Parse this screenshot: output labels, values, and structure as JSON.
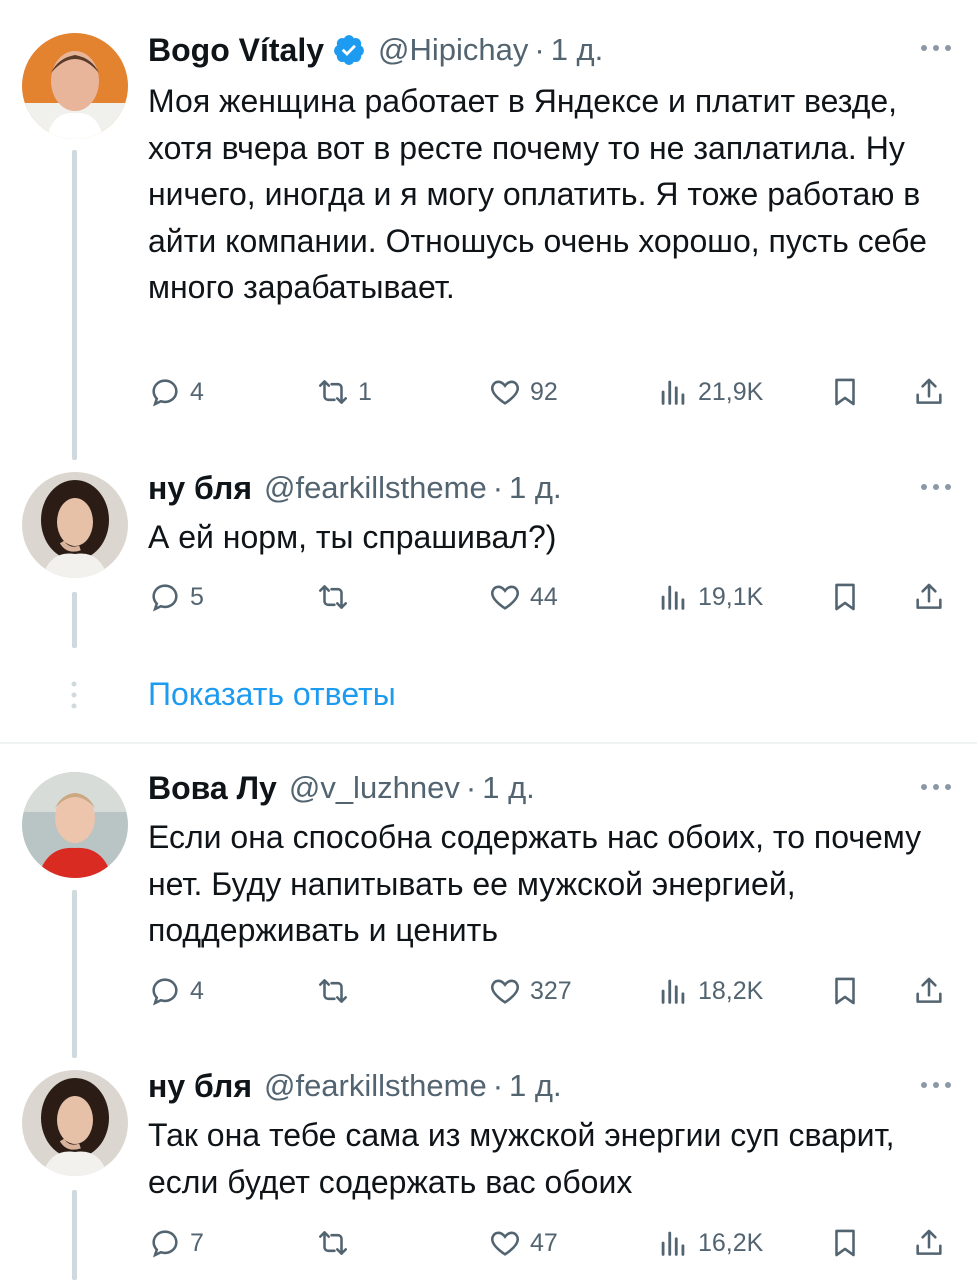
{
  "tweets": [
    {
      "name": "Bogo Vítaly",
      "verified": true,
      "handle": "@Hipichay",
      "dot": "·",
      "time": "1 д.",
      "text": "Моя женщина работает в Яндексе и платит везде, хотя вчера вот в ресте почему то не заплатила. Ну ничего, иногда и я могу оплатить. Я тоже работаю в айти компании. Отношусь очень хорошо, пусть себе много зарабатывает.",
      "replies": "4",
      "retweets": "1",
      "likes": "92",
      "views": "21,9K"
    },
    {
      "name": "ну бля",
      "verified": false,
      "handle": "@fearkillstheme",
      "dot": "·",
      "time": "1 д.",
      "text": "А ей норм, ты спрашивал?)",
      "replies": "5",
      "retweets": "",
      "likes": "44",
      "views": "19,1K"
    },
    {
      "name": "Вова Лу",
      "verified": false,
      "handle": "@v_luzhnev",
      "dot": "·",
      "time": "1 д.",
      "text": "Если она способна содержать нас обоих, то почему нет. Буду напитывать ее мужской энергией, поддерживать и ценить",
      "replies": "4",
      "retweets": "",
      "likes": "327",
      "views": "18,2K"
    },
    {
      "name": "ну бля",
      "verified": false,
      "handle": "@fearkillstheme",
      "dot": "·",
      "time": "1 д.",
      "text": "Так она тебе сама из мужской энергии суп сварит, если будет содержать вас обоих",
      "replies": "7",
      "retweets": "",
      "likes": "47",
      "views": "16,2K"
    }
  ],
  "show_replies_label": "Показать ответы",
  "colors": {
    "accent": "#1d9bf0",
    "secondary_text": "#536471",
    "thread_line": "#cfd9de"
  },
  "icons": [
    "verified-badge-icon",
    "more-icon",
    "reply-icon",
    "retweet-icon",
    "like-icon",
    "views-icon",
    "bookmark-icon",
    "share-icon"
  ]
}
